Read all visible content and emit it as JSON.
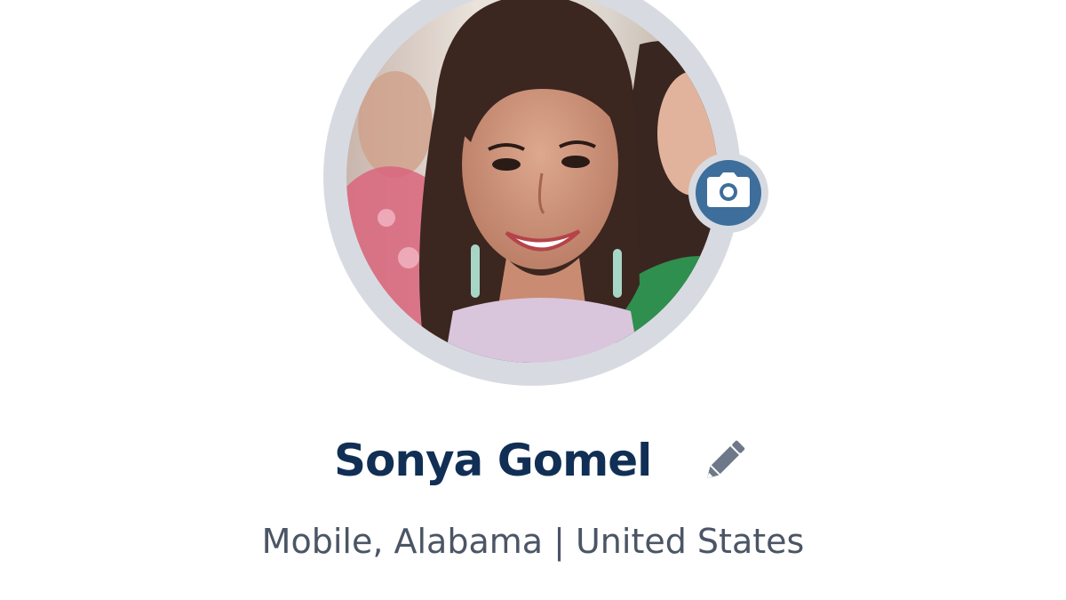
{
  "profile": {
    "name": "Sonya Gomel",
    "location": "Mobile, Alabama | United States"
  },
  "icons": {
    "avatar_action": "camera-icon",
    "name_action": "pencil-icon"
  },
  "colors": {
    "name": "#112f55",
    "location": "#4b5565",
    "accent": "#3d6e9c",
    "ring": "#d7dbe1",
    "background": "#ffffff"
  }
}
